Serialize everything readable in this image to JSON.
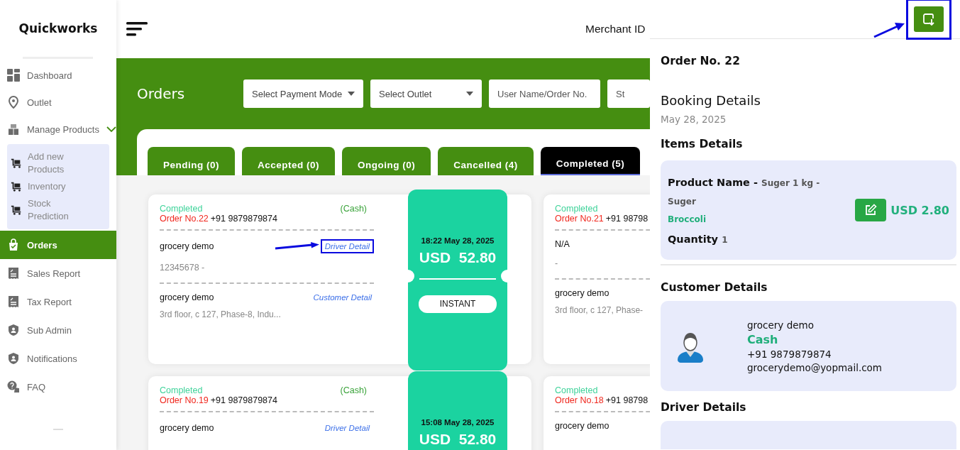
{
  "brand": "Quickworks",
  "sidebar": {
    "items": [
      {
        "label": "Dashboard",
        "kind": "grid",
        "selected": false
      },
      {
        "label": "Outlet",
        "kind": "pin",
        "selected": false
      },
      {
        "label": "Manage Products",
        "kind": "boxes",
        "selected": false,
        "expanded": true,
        "children": [
          {
            "label": "Add new Products",
            "kind": "cart",
            "selected": false
          },
          {
            "label": "Inventory",
            "kind": "cart",
            "selected": false
          },
          {
            "label": "Stock Prediction",
            "kind": "cart",
            "selected": false
          }
        ]
      },
      {
        "label": "Orders",
        "kind": "bag",
        "selected": true
      },
      {
        "label": "Sales Report",
        "kind": "receipt",
        "selected": false
      },
      {
        "label": "Tax Report",
        "kind": "receipt",
        "selected": false
      },
      {
        "label": "Sub Admin",
        "kind": "shield",
        "selected": false
      },
      {
        "label": "Notifications",
        "kind": "shield",
        "selected": false
      },
      {
        "label": "FAQ",
        "kind": "question",
        "selected": false
      }
    ]
  },
  "header": {
    "merchant": "Merchant ID"
  },
  "page_title": "Orders",
  "filters": [
    {
      "kind": "select",
      "value": "Select Payment Mode"
    },
    {
      "kind": "select",
      "value": "Select Outlet"
    },
    {
      "kind": "input",
      "placeholder": "User Name/Order No."
    },
    {
      "kind": "input",
      "placeholder": "St"
    }
  ],
  "tabs": [
    {
      "label": "Pending (0)",
      "selected": false
    },
    {
      "label": "Accepted (0)",
      "selected": false
    },
    {
      "label": "Ongoing (0)",
      "selected": false
    },
    {
      "label": "Cancelled (4)",
      "selected": false
    },
    {
      "label": "Completed (5)",
      "selected": true
    }
  ],
  "orders": [
    {
      "status": "Completed",
      "payment": "(Cash)",
      "order_no": "Order No.22",
      "phone": "+91 9879879874",
      "driver_name": "grocery demo",
      "driver_sub": "12345678 -",
      "driver_link": "Driver Detail",
      "driver_link_highlighted": true,
      "customer_name": "grocery demo",
      "customer_link": "Customer Detail",
      "address": "3rd floor, c 127, Phase-8, Indu...",
      "ticket": {
        "time": "18:22 May 28, 2025",
        "amount": "USD  52.80",
        "type": "INSTANT"
      }
    },
    {
      "status": "Completed",
      "order_no": "Order No.21",
      "phone": "+91 98798",
      "driver_name": "N/A",
      "driver_sub": "-",
      "customer_name": "grocery demo",
      "address": "3rd floor, c 127, Phase-"
    },
    {
      "status": "Completed",
      "payment": "(Cash)",
      "order_no": "Order No.19",
      "phone": "+91 9879879874",
      "driver_name": "grocery demo",
      "driver_link": "Driver Detail",
      "driver_link_highlighted": false,
      "ticket": {
        "time": "15:08 May 28, 2025",
        "amount": "USD  52.80"
      }
    },
    {
      "status": "Completed",
      "order_no": "Order No.18",
      "phone": "+91 98798",
      "driver_name": "grocery demo"
    }
  ],
  "panel": {
    "download_highlighted": true,
    "order_title": "Order No. 22",
    "booking_title": "Booking Details",
    "booking_date": "May 28, 2025",
    "items_title": "Items Details",
    "item": {
      "name_label": "Product Name -",
      "name_value": "Suger 1 kg -",
      "name_extra": "Suger",
      "category": "Broccoli",
      "quantity_label": "Quantity",
      "quantity": "1",
      "price": "USD 2.80"
    },
    "customer_title": "Customer Details",
    "customer": {
      "name": "grocery demo",
      "payment": "Cash",
      "phone": "+91 9879879874",
      "email": "grocerydemo@yopmail.com"
    },
    "driver_title": "Driver Details"
  }
}
